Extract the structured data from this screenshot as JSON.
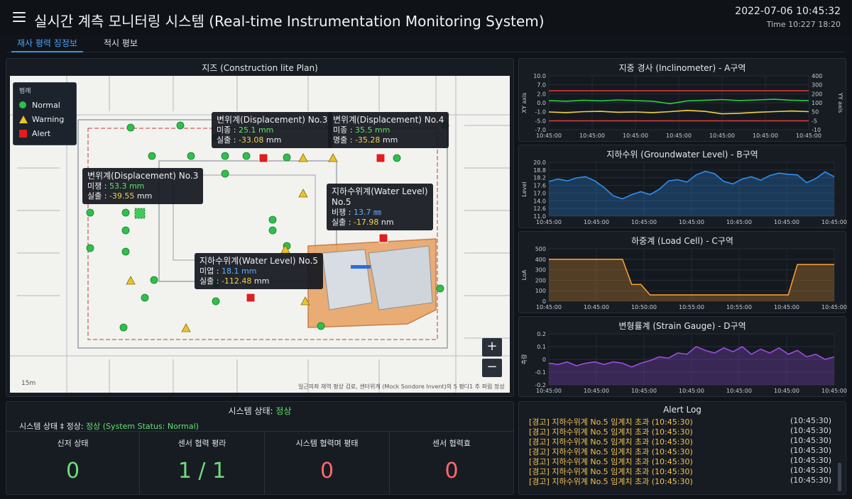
{
  "header": {
    "title": "실시간 계측 모니터링 시스템 (Real-time Instrumentation Monitoring System)",
    "datetime": "2022-07-06 10:45:32",
    "subtime": "Time 10:227 18:20"
  },
  "tabs": [
    {
      "label": "재사 평력 징정보",
      "active": true
    },
    {
      "label": "적시 평보",
      "active": false
    }
  ],
  "map": {
    "title": "지즈 (Construction lite Plan)",
    "legend": {
      "title": "범례",
      "normal": "Normal",
      "warning": "Warning",
      "alert": "Alert"
    },
    "footer": "일근의좌 재역 평상 검료, 센터위게 (Mock Sondore Invent)의 5 평다1 추 퍼럼 정성",
    "scale": "15m",
    "zoom_in": "+",
    "zoom_out": "−",
    "colors": {
      "normal": "#2ec04a",
      "warning": "#e8c42a",
      "alert": "#e11d1d"
    },
    "tooltips": [
      {
        "title": "변위계(Displacement) No.3",
        "l1": "미종 :",
        "v1": "25.1 mm",
        "l2": "실출 :",
        "v2": "-33.08",
        "u2": "mm"
      },
      {
        "title": "변위계(Displacement) No.4",
        "l1": "미종 :",
        "v1": "35.5 mm",
        "l2": "명출 :",
        "v2": "-35.28",
        "u2": "mm"
      },
      {
        "title": "변위계(Displacement) No.3",
        "l1": "미쟁 :",
        "v1": "53.3 mm",
        "l2": "실출 :",
        "v2": "-39.55",
        "u2": "mm"
      },
      {
        "title": "지하수위계(Water Level)",
        "title2": "No.5",
        "l1": "비쟁 :",
        "v1": "13.7 ㎜",
        "l2": "실출 :",
        "v2": "-17.98",
        "u2": "nm"
      },
      {
        "title": "지하수위계(Water Level) No.5",
        "l1": "미엽 :",
        "v1": "18.1 mm",
        "l2": "실출 :",
        "v2": "-112.48",
        "u2": "mm"
      }
    ]
  },
  "charts": [
    {
      "title": "지중 경사 (Inclinometer) - A구역",
      "ylabel_left": "XY axis",
      "ylabel_right": "YY axis",
      "left_ticks": [
        "10.0",
        "7.0",
        "2.0",
        "0.0",
        "-1.0",
        "-5.0",
        "-7.0"
      ],
      "right_ticks": [
        "400",
        "300",
        "200",
        "100",
        "50",
        "-5",
        "-10"
      ],
      "x_ticks": [
        "10:45:00",
        "10:45:00",
        "10:45:00",
        "10:45:00",
        "10:45:00",
        "10:45:00",
        "10:45:00"
      ]
    },
    {
      "title": "지하수위 (Groundwater Level) - B구역",
      "ylabel_left": "Level",
      "left_ticks": [
        "20.0",
        "18.8",
        "18.2",
        "17.6",
        "17.0",
        "14.0",
        "12.6",
        "11.0"
      ],
      "x_ticks": [
        "10:45:00",
        "10:45:00",
        "10:45:00",
        "10:45:00",
        "10:45:00",
        "10:45:00",
        "10:45:00"
      ]
    },
    {
      "title": "하중계 (Load Cell) - C구역",
      "ylabel_left": "LoA",
      "left_ticks": [
        "500",
        "400",
        "300",
        "200",
        "100",
        "0"
      ],
      "x_ticks": [
        "10:45:00",
        "10:45:00",
        "10:50:00",
        "10:55:00",
        "10:55:00",
        "10:45:00",
        "10:45:00"
      ]
    },
    {
      "title": "변형률계 (Strain Gauge) - D구역",
      "ylabel_left": "측량",
      "left_ticks": [
        "0.2",
        "0.1",
        "0",
        "-0.1",
        "-0.2"
      ],
      "x_ticks": [
        "10:45:00",
        "10:45:00",
        "10:45:00",
        "10:45:00",
        "10:45:00",
        "10:45:00",
        "10:45:00"
      ]
    }
  ],
  "chart_data": [
    {
      "type": "line",
      "title": "지중 경사 (Inclinometer) - A구역",
      "ylabel": "XY axis",
      "y2label": "YY axis",
      "ylim": [
        -7.0,
        10.0
      ],
      "series": [
        {
          "color": "#e53935",
          "values": [
            5.3,
            5.3,
            5.3,
            5.3,
            5.3,
            5.3,
            5.3,
            5.3,
            5.3,
            5.3,
            5.3,
            5.3,
            5.3,
            5.3,
            5.3,
            5.3
          ]
        },
        {
          "color": "#2ecc40",
          "values": [
            2.2,
            2.0,
            2.3,
            2.1,
            2.4,
            2.2,
            2.0,
            1.2,
            2.1,
            2.3,
            2.5,
            2.2,
            2.4,
            2.6,
            2.3,
            2.2
          ]
        },
        {
          "color": "#f2d13a",
          "values": [
            -1.4,
            -1.6,
            -1.3,
            -1.2,
            -1.5,
            -1.4,
            -1.6,
            -1.3,
            -0.9,
            -1.2,
            -2.0,
            -1.8,
            -1.5,
            -1.3,
            -1.1,
            -1.3
          ]
        },
        {
          "color": "#e53935",
          "values": [
            -4.2,
            -4.2,
            -4.2,
            -4.2,
            -4.2,
            -4.2,
            -4.2,
            -4.2,
            -4.2,
            -4.2,
            -4.2,
            -4.2,
            -4.2,
            -4.2,
            -4.2,
            -4.2
          ]
        }
      ]
    },
    {
      "type": "area",
      "title": "지하수위 (Groundwater Level) - B구역",
      "ylabel": "Level",
      "ylim": [
        11.0,
        20.0
      ],
      "series": [
        {
          "color": "#2d8ff0",
          "values": [
            16.8,
            17.2,
            16.9,
            17.4,
            17.6,
            16.9,
            15.8,
            14.4,
            13.9,
            14.6,
            15.1,
            14.6,
            15.5,
            16.9,
            17.1,
            16.7,
            17.9,
            18.5,
            18.1,
            16.8,
            16.4,
            17.2,
            17.6,
            17.0,
            17.8,
            18.2,
            18.0,
            17.9,
            16.6,
            17.3,
            18.4,
            17.6
          ]
        }
      ]
    },
    {
      "type": "area",
      "title": "하중계 (Load Cell) - C구역",
      "ylabel": "LoA",
      "ylim": [
        0,
        500
      ],
      "series": [
        {
          "color": "#f39c33",
          "values": [
            400,
            400,
            400,
            400,
            400,
            400,
            400,
            400,
            400,
            160,
            160,
            60,
            60,
            60,
            60,
            60,
            60,
            60,
            60,
            60,
            60,
            60,
            60,
            60,
            60,
            60,
            60,
            350,
            350,
            350,
            350,
            350
          ]
        }
      ]
    },
    {
      "type": "area",
      "title": "변형률계 (Strain Gauge) - D구역",
      "ylabel": "측량",
      "ylim": [
        -0.2,
        0.2
      ],
      "series": [
        {
          "color": "#9b4de0",
          "values": [
            -0.03,
            -0.04,
            -0.02,
            -0.05,
            -0.03,
            -0.02,
            -0.04,
            -0.02,
            -0.03,
            -0.06,
            -0.03,
            -0.01,
            0.02,
            0.01,
            0.05,
            0.04,
            0.1,
            0.07,
            0.05,
            0.09,
            0.06,
            0.1,
            0.04,
            0.08,
            0.05,
            0.09,
            0.04,
            0.07,
            0.02,
            0.04,
            0.0,
            0.02
          ]
        }
      ]
    }
  ],
  "status": {
    "title_label": "시스템 상태:",
    "title_value": "정상",
    "line_label": "시스템 상태 ‡ 정상:",
    "line_value": "정상 (System Status: Normal)",
    "cells": [
      {
        "label": "신저 상태",
        "value": "0",
        "color": "#6fdc7a"
      },
      {
        "label": "센서 협력 평라",
        "value": "1 / 1",
        "color": "#6fdc7a"
      },
      {
        "label": "시스템 협력며 평태",
        "value": "0",
        "color": "#ff6a6a"
      },
      {
        "label": "센서 협력효",
        "value": "0",
        "color": "#ff6a6a"
      }
    ]
  },
  "alert_log": {
    "title": "Alert Log",
    "items": [
      {
        "msg": "[경고] 지하수위계 No.5 임계치 초과 (10:45:30)",
        "time": "(10:45:30)"
      },
      {
        "msg": "[경고] 지하수위계 No.5 임계치 초과 (10:45:30)",
        "time": "(10:45:30)"
      },
      {
        "msg": "[경고] 지하수위계 No.5 임계치 초과 (10:45:30)",
        "time": "(10:45:30)"
      },
      {
        "msg": "[경고] 지하수위계 No.5 임계치 초과 (10:45:30)",
        "time": "(10:45:30)"
      },
      {
        "msg": "[경고] 지하수위계 No.5 임계치 초과 (10:45:30)",
        "time": "(10:45:30)"
      },
      {
        "msg": "[경고] 지하수위계 No.5 임계치 초과 (10:45:30)",
        "time": "(10:45:30)"
      },
      {
        "msg": "[경고] 지하수위계 No.5 임계치 초과 (10:45:30)",
        "time": "(10:45:30)"
      }
    ]
  }
}
